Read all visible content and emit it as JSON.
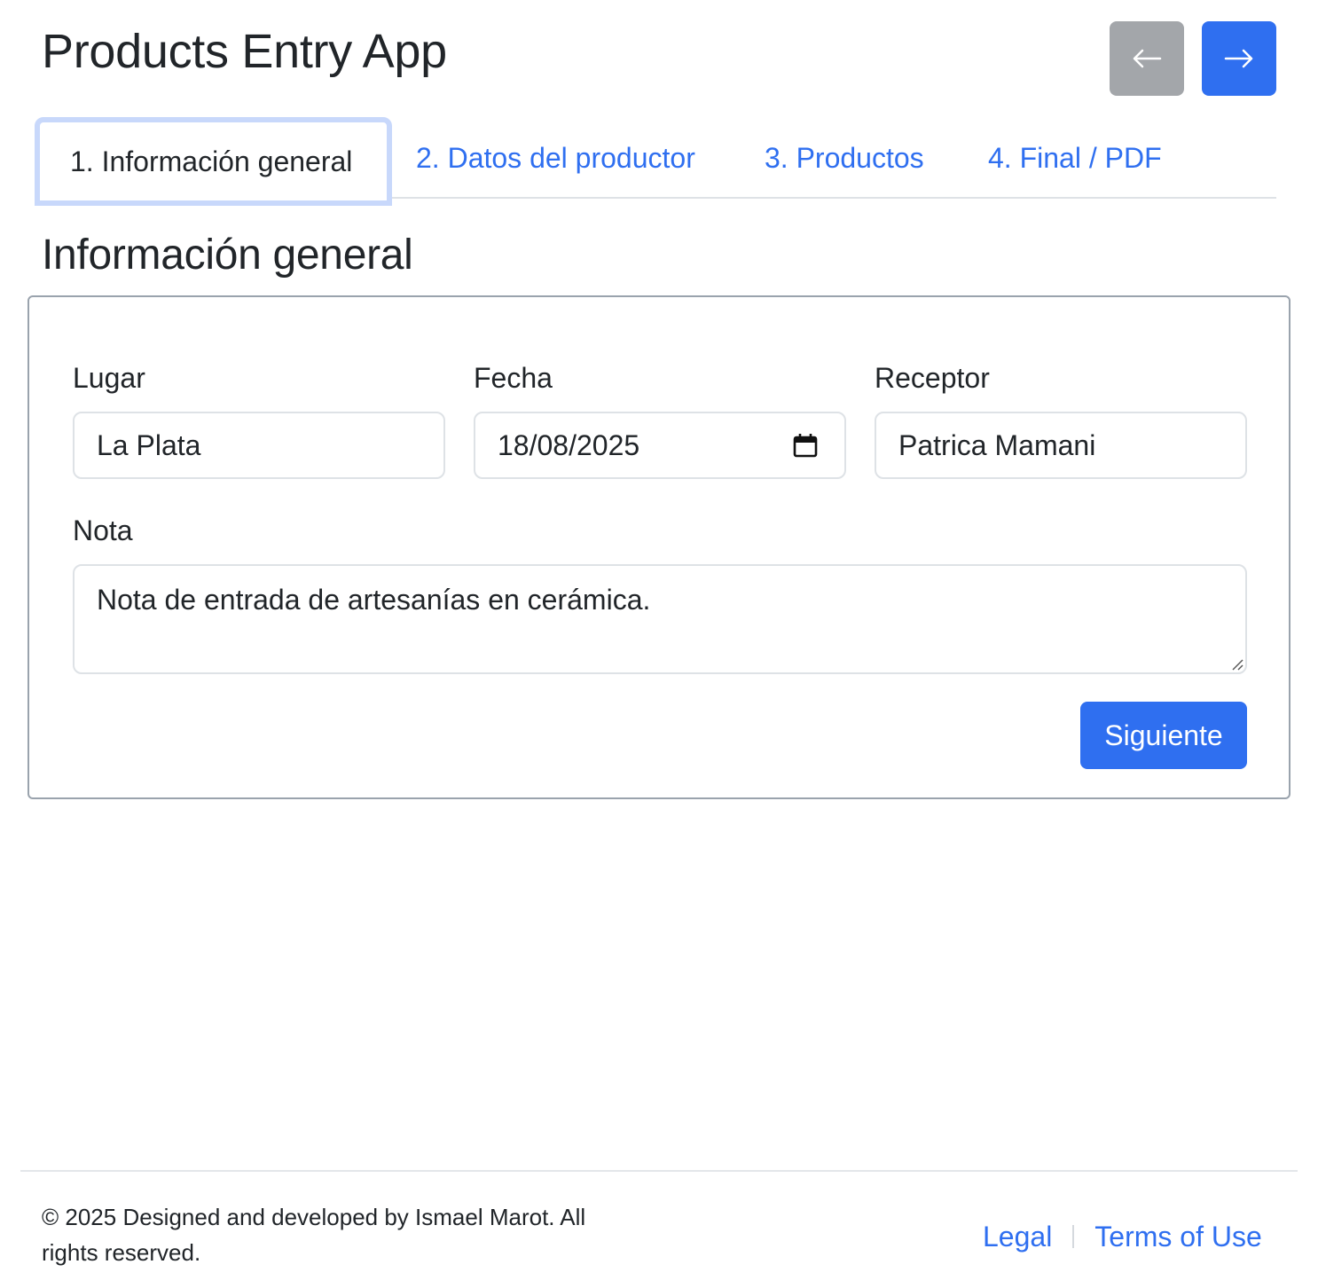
{
  "header": {
    "title": "Products Entry App",
    "prev_button_icon": "arrow-left-icon",
    "next_button_icon": "arrow-right-icon"
  },
  "tabs": [
    {
      "label": "1. Información general",
      "active": true
    },
    {
      "label": "2. Datos del productor",
      "active": false
    },
    {
      "label": "3. Productos",
      "active": false
    },
    {
      "label": "4. Final / PDF",
      "active": false
    }
  ],
  "section": {
    "title": "Información general"
  },
  "form": {
    "lugar": {
      "label": "Lugar",
      "value": "La Plata"
    },
    "fecha": {
      "label": "Fecha",
      "value": "18/08/2025",
      "icon": "calendar-icon"
    },
    "receptor": {
      "label": "Receptor",
      "value": "Patrica Mamani"
    },
    "nota": {
      "label": "Nota",
      "value": "Nota de entrada de artesanías en cerámica."
    },
    "submit_label": "Siguiente"
  },
  "footer": {
    "copyright": "© 2025 Designed and developed by Ismael Marot. All rights reserved.",
    "links": [
      "Legal",
      "Terms of Use"
    ]
  },
  "colors": {
    "primary": "#2f6ff0",
    "secondary": "#a3a6aa",
    "text": "#212529",
    "border": "#dee2e6"
  }
}
